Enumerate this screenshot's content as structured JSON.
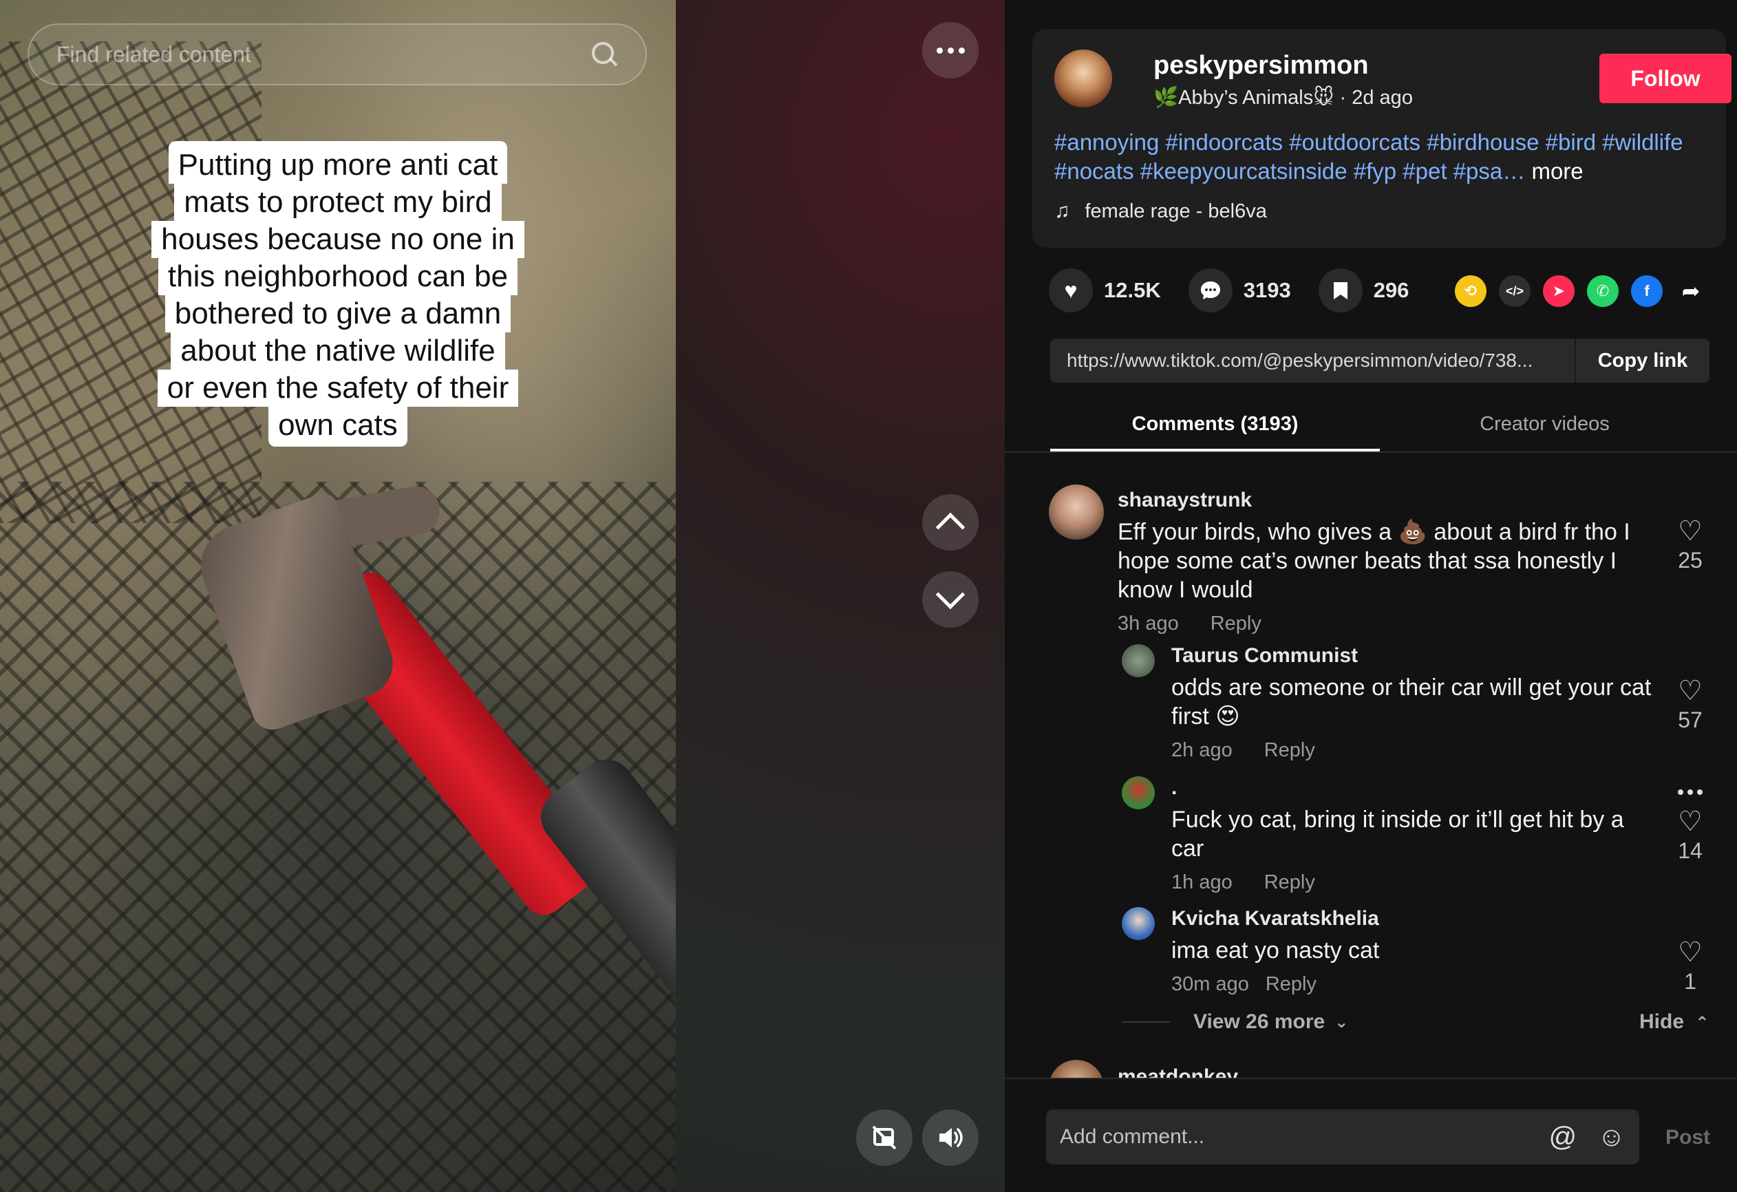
{
  "video": {
    "search_placeholder": "Find related content",
    "caption_lines": [
      "Putting up more anti cat",
      "mats to protect my bird",
      "houses because no one in",
      "this neighborhood can be",
      "bothered to give a damn",
      "about the native wildlife",
      "or even the safety of their",
      "own cats"
    ]
  },
  "author": {
    "name": "peskypersimmon",
    "subtitle": "🌿Abby’s Animals🐭 · 2d ago",
    "follow_label": "Follow",
    "hashtags": "#annoying #indoorcats #outdoorcats #birdhouse #bird #wildlife #nocats #keepyourcatsinside #fyp #pet #psa…",
    "more_label": "more",
    "music": "female rage - bel6va"
  },
  "stats": {
    "likes": "12.5K",
    "comments": "3193",
    "saves": "296"
  },
  "share": {
    "link_url": "https://www.tiktok.com/@peskypersimmon/video/738...",
    "copy_label": "Copy link"
  },
  "tabs": [
    {
      "label": "Comments (3193)"
    },
    {
      "label": "Creator videos"
    }
  ],
  "comments": [
    {
      "username": "shanaystrunk",
      "text_lines": [
        "Eff your birds, who gives a 💩 about a bird fr tho I",
        "hope some cat’s owner beats that ssa honestly I",
        "know I would"
      ],
      "time": "3h ago",
      "reply_label": "Reply",
      "likes": "25"
    },
    {
      "username": "Taurus Communist",
      "text_lines": [
        "odds are someone or their car will get your cat",
        "first 😍"
      ],
      "time": "2h ago",
      "reply_label": "Reply",
      "likes": "57"
    },
    {
      "username": ".",
      "text_lines": [
        "Fuck yo cat, bring it inside or it’ll get hit by a",
        "car"
      ],
      "time": "1h ago",
      "reply_label": "Reply",
      "likes": "14"
    },
    {
      "username": "Kvicha Kvaratskhelia",
      "text_lines": [
        "ima eat yo nasty cat"
      ],
      "time": "30m ago",
      "reply_label": "Reply",
      "likes": "1"
    },
    {
      "username": "meatdonkey"
    }
  ],
  "thread": {
    "view_more": "View 26 more",
    "hide": "Hide"
  },
  "composer": {
    "placeholder": "Add comment...",
    "post_label": "Post"
  },
  "colors": {
    "accent": "#fe2c55",
    "hashtag": "#7fb0ff",
    "background": "#121212"
  }
}
